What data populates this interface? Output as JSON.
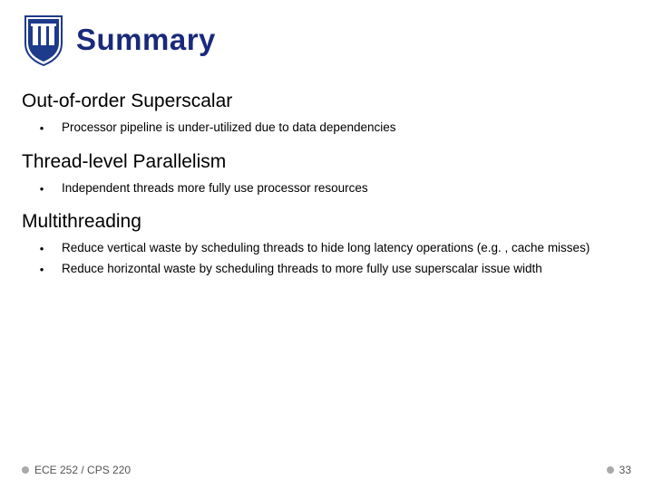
{
  "title": "Summary",
  "sections": [
    {
      "heading": "Out-of-order Superscalar",
      "bullets": [
        "Processor pipeline is under-utilized due to data dependencies"
      ]
    },
    {
      "heading": "Thread-level Parallelism",
      "bullets": [
        "Independent threads more fully use processor resources"
      ]
    },
    {
      "heading": "Multithreading",
      "bullets": [
        "Reduce vertical waste by scheduling threads to hide long latency operations (e.g. , cache misses)",
        "Reduce horizontal waste by scheduling threads to more fully use superscalar issue width"
      ]
    }
  ],
  "footer": {
    "course": "ECE 252 / CPS 220",
    "page": "33"
  },
  "logo": {
    "bg": "#1e3a8a",
    "accent": "#ffffff"
  }
}
